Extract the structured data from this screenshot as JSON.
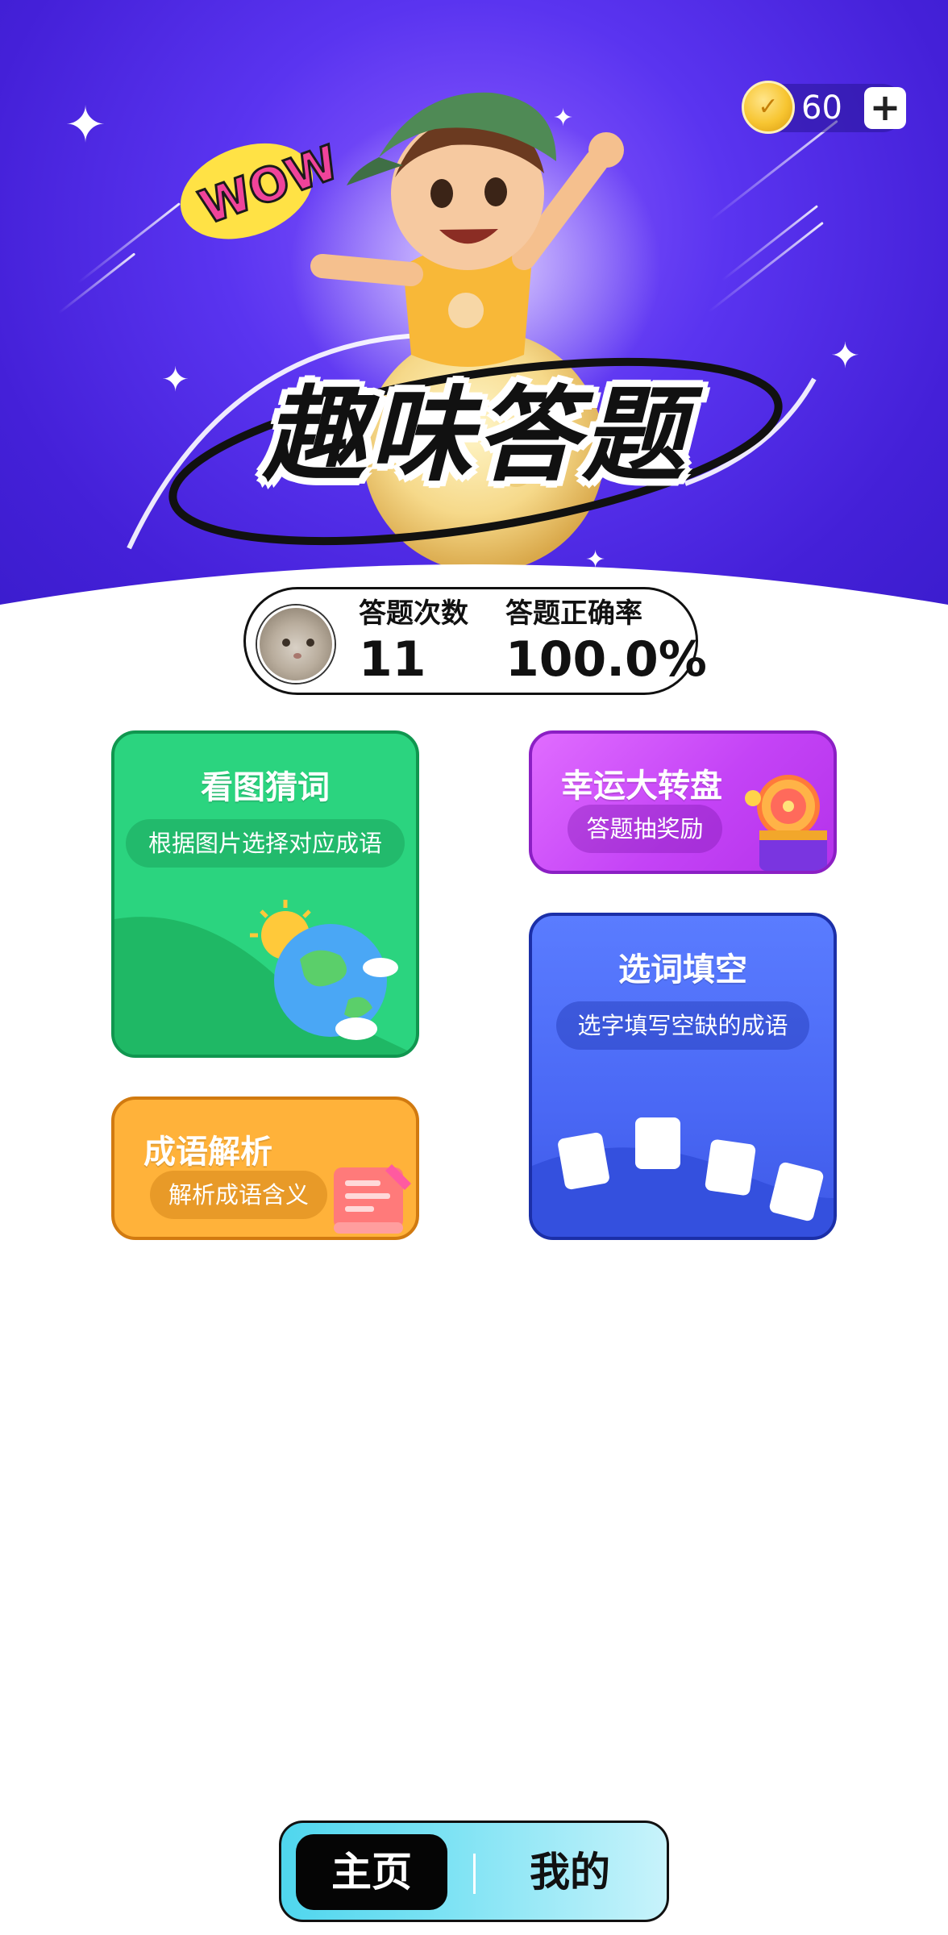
{
  "header": {
    "coins": "60",
    "add_label": "+",
    "title": "趣味答题",
    "sticker": "WOW"
  },
  "stats": {
    "count_label": "答题次数",
    "count_value": "11",
    "accuracy_label": "答题正确率",
    "accuracy_value": "100.0%"
  },
  "cards": {
    "picture_guess": {
      "title": "看图猜词",
      "subtitle": "根据图片选择对应成语"
    },
    "lucky_wheel": {
      "title": "幸运大转盘",
      "subtitle": "答题抽奖励"
    },
    "fill_blank": {
      "title": "选词填空",
      "subtitle": "选字填写空缺的成语"
    },
    "idiom_analysis": {
      "title": "成语解析",
      "subtitle": "解析成语含义"
    }
  },
  "nav": {
    "home": "主页",
    "mine": "我的"
  },
  "colors": {
    "hero_purple": "#4a24dd",
    "green_card": "#2bd47f",
    "purple_card": "#c443f6",
    "blue_card": "#4a68f5",
    "orange_card": "#ffb23a",
    "nav_cyan": "#4fd6ee"
  },
  "icons": [
    "coin-icon",
    "plus-icon",
    "sparkle-icon",
    "avatar",
    "globe-icon",
    "sun-icon",
    "lucky-wheel-icon",
    "scroll-icon",
    "card-tile-icon"
  ]
}
